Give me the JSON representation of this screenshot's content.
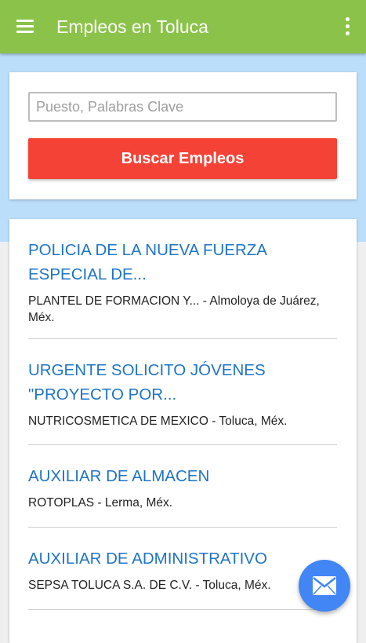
{
  "appbar": {
    "title": "Empleos en Toluca",
    "menu_icon": "menu-icon",
    "more_icon": "more-vert-icon"
  },
  "search": {
    "placeholder": "Puesto, Palabras Clave",
    "value": "",
    "button_label": "Buscar Empleos"
  },
  "jobs": [
    {
      "title": "POLICIA DE LA NUEVA FUERZA ESPECIAL DE...",
      "meta": "PLANTEL DE FORMACION Y... - Almoloya de Juárez, Méx."
    },
    {
      "title": "URGENTE SOLICITO JÓVENES \"PROYECTO POR...",
      "meta": "NUTRICOSMETICA DE MEXICO - Toluca, Méx."
    },
    {
      "title": "AUXILIAR DE ALMACEN",
      "meta": "ROTOPLAS - Lerma, Méx."
    },
    {
      "title": "AUXILIAR DE ADMINISTRATIVO",
      "meta": "SEPSA TOLUCA S.A. DE C.V. - Toluca, Méx."
    }
  ],
  "fab": {
    "icon": "email-icon"
  },
  "colors": {
    "appbar": "#8bc34a",
    "hero": "#bbdefb",
    "search_button": "#f44336",
    "job_title": "#1e74c6",
    "fab": "#4285f4"
  }
}
